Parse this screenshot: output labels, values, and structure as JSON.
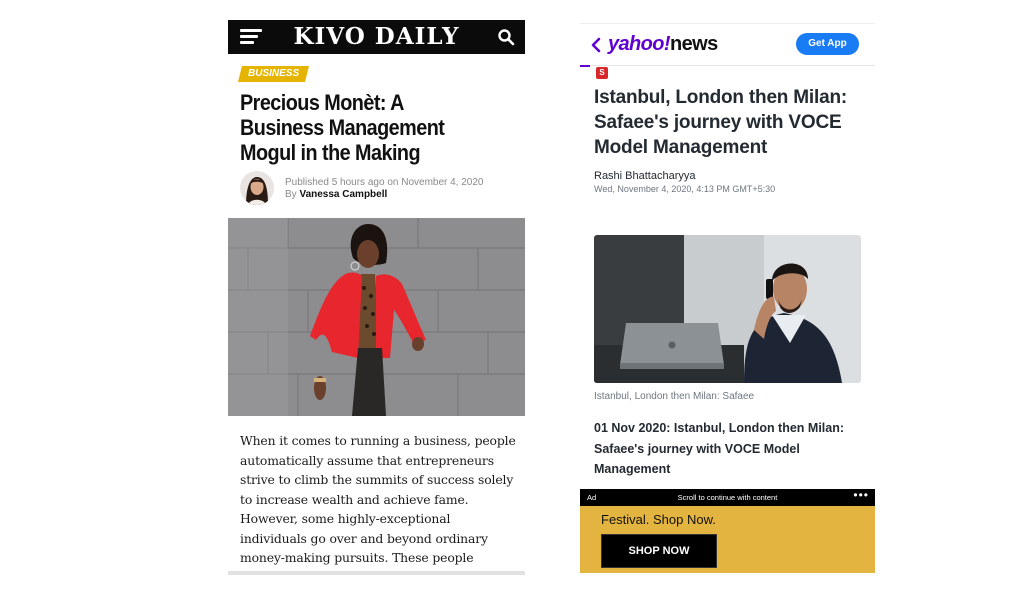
{
  "kivo": {
    "logo": "KIVO DAILY",
    "category": "BUSINESS",
    "headline": "Precious Monèt: A Business Management Mogul in the Making",
    "meta": {
      "published_label": "Published",
      "time_ago": "5 hours ago",
      "on_label": "on",
      "date": "November 4, 2020",
      "by_label": "By",
      "author": "Vanessa Campbell"
    },
    "body": "When it comes to running a business, people automatically assume that entrepreneurs strive to climb the summits of success solely to increase wealth and achieve fame. However, some highly-exceptional individuals go over and beyond ordinary money-making pursuits. These people pursue success for reasons",
    "icons": {
      "menu": "hamburger-menu-icon",
      "search": "search-icon"
    },
    "colors": {
      "header": "#0b0b0b",
      "badge": "#e5b400",
      "blazer": "#e8262e"
    }
  },
  "yahoo": {
    "brand_yahoo": "yahoo!",
    "brand_news": "news",
    "get_app": "Get App",
    "source_icon": "S",
    "title": "Istanbul, London then Milan: Safaee's journey with VOCE Model Management",
    "author": "Rashi Bhattacharyya",
    "date": "Wed, November 4, 2020, 4:13 PM GMT+5:30",
    "caption": "Istanbul, London then Milan: Safaee",
    "subhead": "01 Nov 2020: Istanbul, London then Milan: Safaee's journey with VOCE Model Management",
    "ad": {
      "label": "Ad",
      "scroll_text": "Scroll to continue with content",
      "more": "•••",
      "text": "Festival. Shop Now.",
      "button": "SHOP NOW"
    },
    "icons": {
      "back": "back-chevron-icon",
      "more": "more-icon"
    },
    "colors": {
      "brand": "#6001d2",
      "button": "#1a7cf5",
      "ad_bg": "#e3b43f"
    }
  }
}
